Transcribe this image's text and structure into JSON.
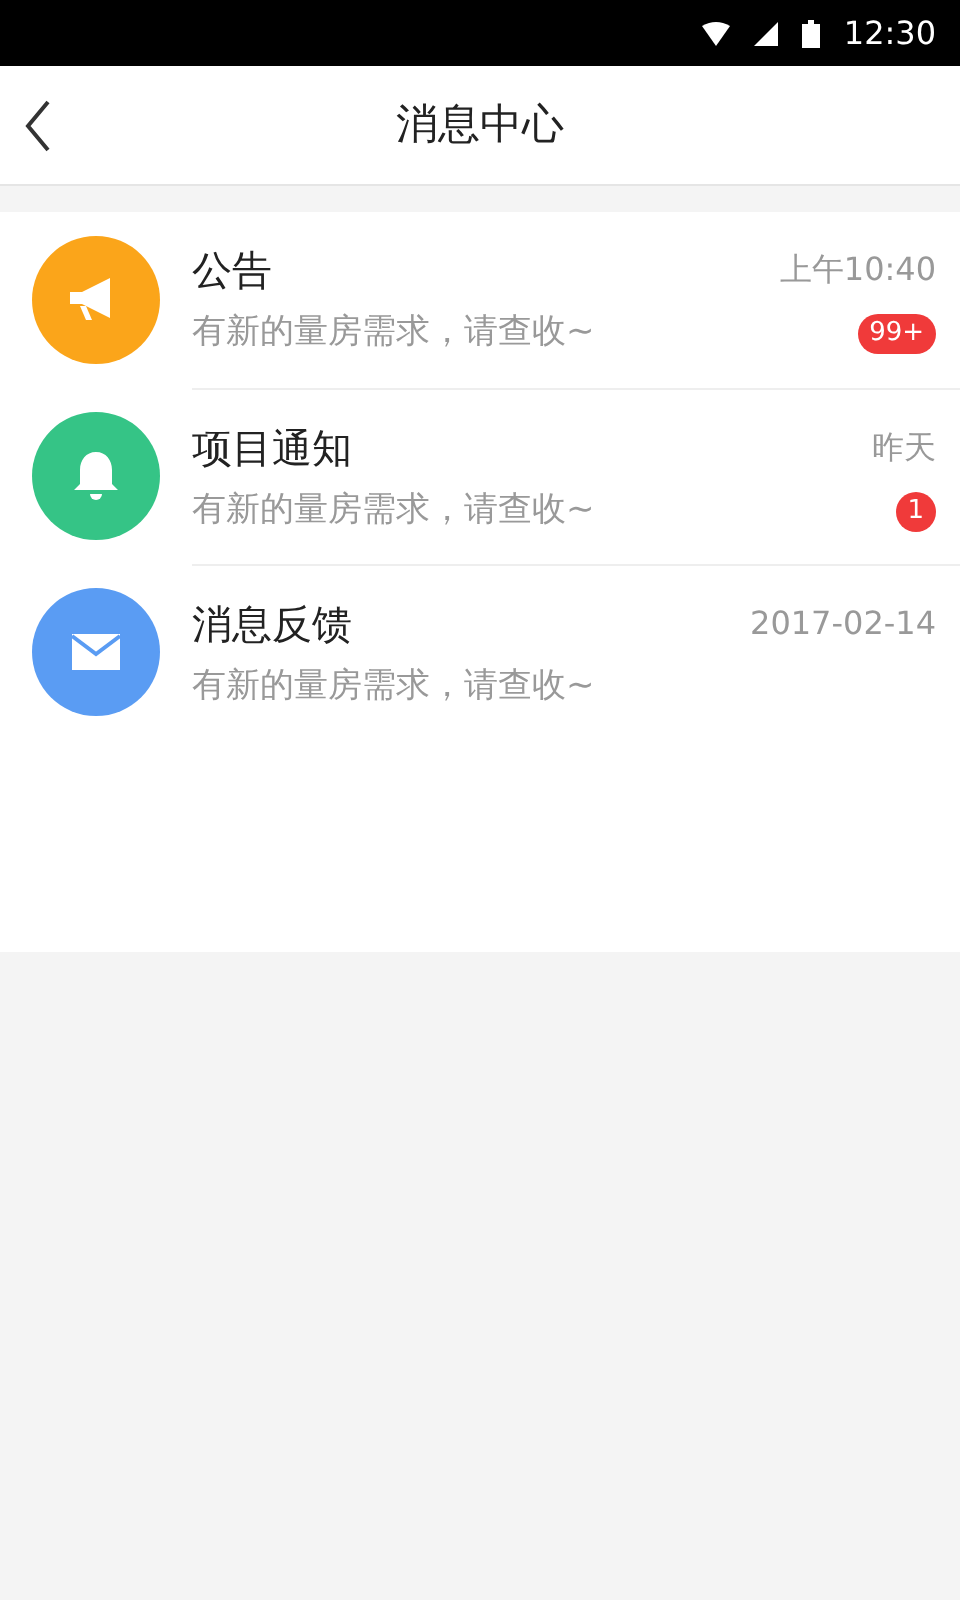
{
  "status_bar": {
    "time": "12:30"
  },
  "header": {
    "title": "消息中心"
  },
  "messages": [
    {
      "title": "公告",
      "preview": "有新的量房需求，请查收~",
      "time": "上午10:40",
      "badge": "99+",
      "kind": "megaphone",
      "color": "#fba51a"
    },
    {
      "title": "项目通知",
      "preview": "有新的量房需求，请查收~",
      "time": "昨天",
      "badge": "1",
      "kind": "bell",
      "color": "#35c486"
    },
    {
      "title": "消息反馈",
      "preview": "有新的量房需求，请查收~",
      "time": "2017-02-14",
      "kind": "mail",
      "color": "#5a9cf3"
    }
  ]
}
